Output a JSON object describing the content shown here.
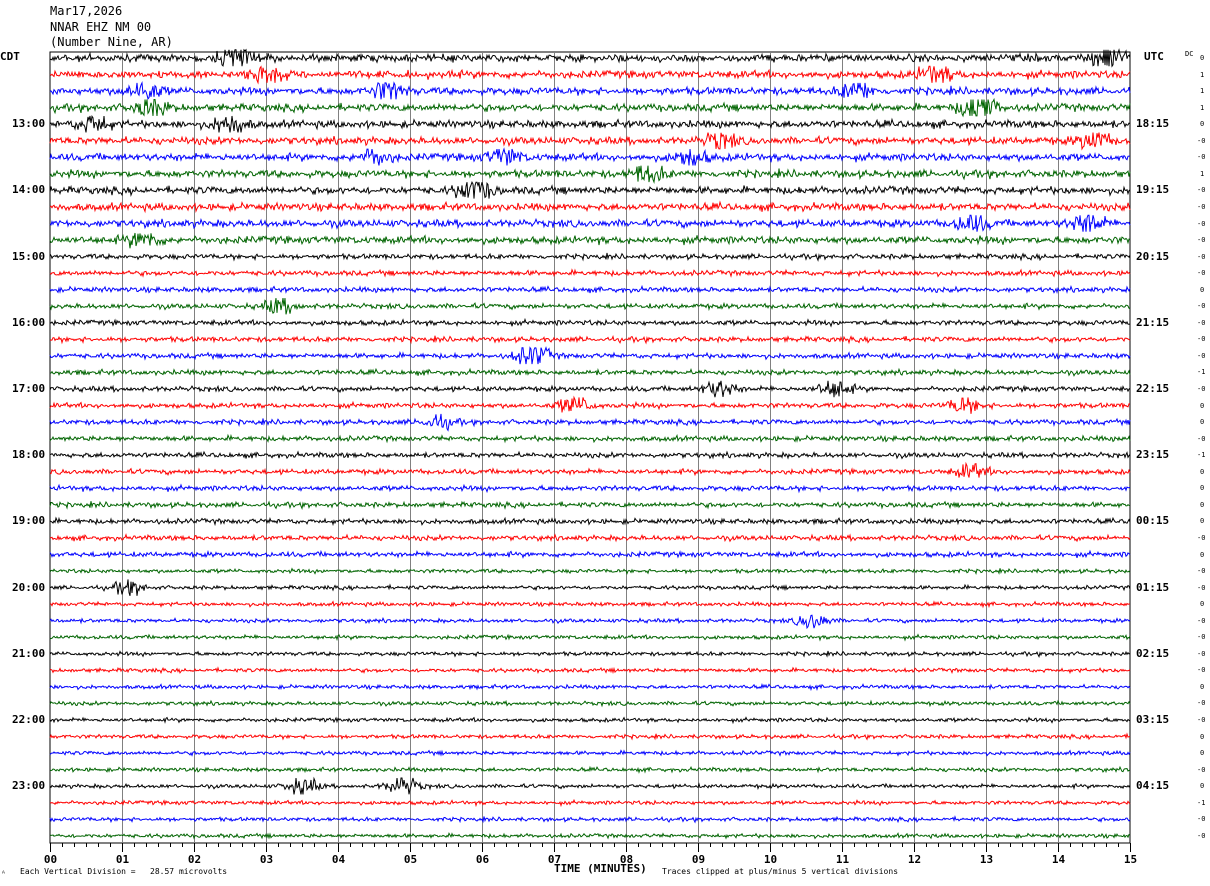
{
  "header": {
    "date": "Mar17,2026",
    "station": "NNAR EHZ NM 00",
    "location": "(Number Nine, AR)"
  },
  "left_tz": "CDT",
  "right_tz": "UTC",
  "dc_label": "DC",
  "footer": {
    "scale_note": "Each Vertical Division =   28.57 microvolts",
    "clip_note": "Traces clipped at plus/minus 5 vertical divisions",
    "corner_mark": "ᴬ"
  },
  "chart_data": {
    "type": "line",
    "title": "",
    "xlabel": "TIME (MINUTES)",
    "xlim": [
      0,
      15
    ],
    "x_ticks": [
      "00",
      "01",
      "02",
      "03",
      "04",
      "05",
      "06",
      "07",
      "08",
      "09",
      "10",
      "11",
      "12",
      "13",
      "14",
      "15"
    ],
    "minutes_per_line": 15,
    "trace_count": 48,
    "trace_colors": [
      "#000000",
      "#ff0000",
      "#0000ff",
      "#006400"
    ],
    "left_hour_labels": [
      "13:00",
      "14:00",
      "15:00",
      "16:00",
      "17:00",
      "18:00",
      "19:00",
      "20:00",
      "21:00",
      "22:00",
      "23:00"
    ],
    "right_hour_labels": [
      "18:15",
      "19:15",
      "20:15",
      "21:15",
      "22:15",
      "23:15",
      "00:15",
      "01:15",
      "02:15",
      "03:15",
      "04:15"
    ],
    "dc_offsets": [
      "0",
      "1",
      "1",
      "1",
      "0",
      "-0",
      "-0",
      "1",
      "-0",
      "-0",
      "-0",
      "-0",
      "-0",
      "-0",
      "0",
      "-0",
      "-0",
      "-0",
      "-0",
      "-1",
      "-0",
      "0",
      "0",
      "-0",
      "-1",
      "0",
      "0",
      "0",
      "0",
      "-0",
      "0",
      "-0",
      "-0",
      "0",
      "-0",
      "-0",
      "-0",
      "-0",
      "0",
      "-0",
      "-0",
      "0",
      "0",
      "-0",
      "0",
      "-1",
      "-0",
      "-0"
    ],
    "events": [
      {
        "trace": 0,
        "minute": 2.6,
        "amp": 1.3
      },
      {
        "trace": 0,
        "minute": 14.7,
        "amp": 1.4
      },
      {
        "trace": 1,
        "minute": 3.0,
        "amp": 0.9
      },
      {
        "trace": 1,
        "minute": 12.3,
        "amp": 1.0
      },
      {
        "trace": 2,
        "minute": 1.3,
        "amp": 1.0
      },
      {
        "trace": 2,
        "minute": 4.7,
        "amp": 1.1
      },
      {
        "trace": 2,
        "minute": 11.2,
        "amp": 0.9
      },
      {
        "trace": 3,
        "minute": 12.9,
        "amp": 2.2
      },
      {
        "trace": 3,
        "minute": 1.4,
        "amp": 1.0
      },
      {
        "trace": 4,
        "minute": 2.5,
        "amp": 1.1
      },
      {
        "trace": 4,
        "minute": 0.6,
        "amp": 0.9
      },
      {
        "trace": 5,
        "minute": 9.3,
        "amp": 0.8
      },
      {
        "trace": 5,
        "minute": 14.5,
        "amp": 0.9
      },
      {
        "trace": 6,
        "minute": 4.5,
        "amp": 0.9
      },
      {
        "trace": 6,
        "minute": 6.3,
        "amp": 0.9
      },
      {
        "trace": 6,
        "minute": 8.9,
        "amp": 0.9
      },
      {
        "trace": 7,
        "minute": 8.3,
        "amp": 1.0
      },
      {
        "trace": 8,
        "minute": 5.9,
        "amp": 1.6
      },
      {
        "trace": 10,
        "minute": 12.8,
        "amp": 0.9
      },
      {
        "trace": 10,
        "minute": 14.4,
        "amp": 1.2
      },
      {
        "trace": 11,
        "minute": 1.3,
        "amp": 0.8
      },
      {
        "trace": 15,
        "minute": 3.2,
        "amp": 0.8
      },
      {
        "trace": 18,
        "minute": 6.7,
        "amp": 1.4
      },
      {
        "trace": 20,
        "minute": 9.3,
        "amp": 0.9
      },
      {
        "trace": 20,
        "minute": 10.9,
        "amp": 0.9
      },
      {
        "trace": 21,
        "minute": 7.3,
        "amp": 1.0
      },
      {
        "trace": 21,
        "minute": 12.7,
        "amp": 0.8
      },
      {
        "trace": 22,
        "minute": 5.4,
        "amp": 0.7
      },
      {
        "trace": 25,
        "minute": 12.8,
        "amp": 0.7
      },
      {
        "trace": 32,
        "minute": 1.1,
        "amp": 0.7
      },
      {
        "trace": 34,
        "minute": 10.6,
        "amp": 0.8
      },
      {
        "trace": 44,
        "minute": 3.5,
        "amp": 0.9
      },
      {
        "trace": 44,
        "minute": 4.9,
        "amp": 1.0
      }
    ]
  }
}
